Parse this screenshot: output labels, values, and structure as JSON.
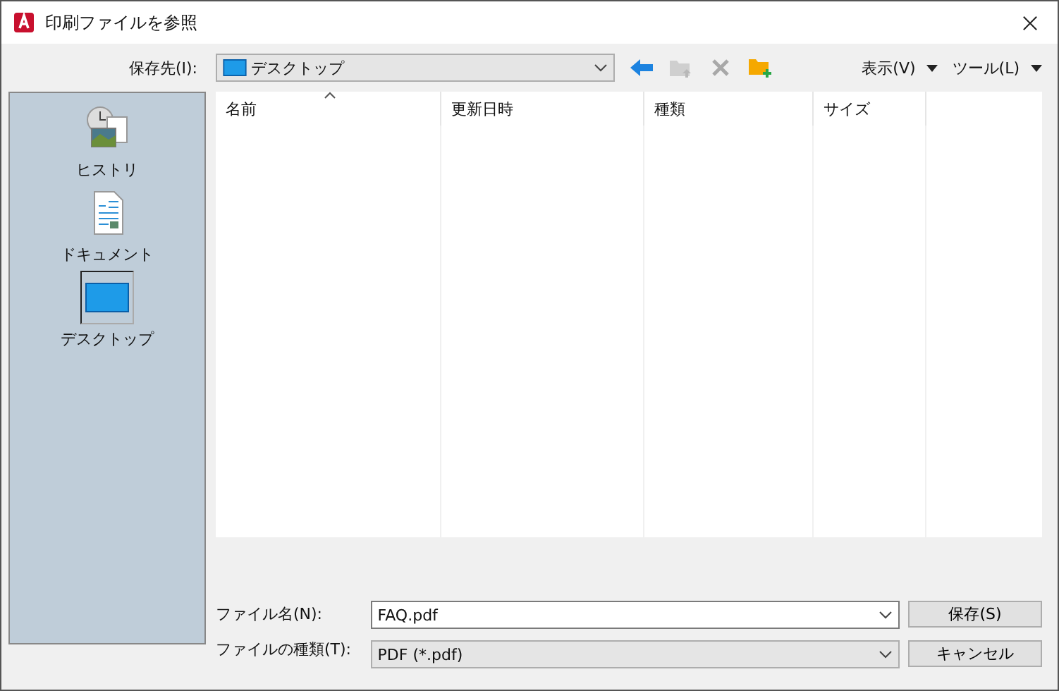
{
  "window": {
    "title": "印刷ファイルを参照"
  },
  "toolbar": {
    "location_label": "保存先(I):",
    "location_value": "デスクトップ",
    "menus": [
      "表示(V)",
      "ツール(L)"
    ]
  },
  "sidebar": {
    "items": [
      {
        "label": "ヒストリ",
        "kind": "history",
        "selected": false
      },
      {
        "label": "ドキュメント",
        "kind": "document",
        "selected": false
      },
      {
        "label": "デスクトップ",
        "kind": "desktop",
        "selected": true
      }
    ]
  },
  "table": {
    "columns": [
      {
        "label": "名前",
        "sorted": true
      },
      {
        "label": "更新日時",
        "sorted": false
      },
      {
        "label": "種類",
        "sorted": false
      },
      {
        "label": "サイズ",
        "sorted": false
      }
    ]
  },
  "form": {
    "fields": [
      {
        "label": "ファイル名(N):",
        "value": "FAQ.pdf",
        "editable": true
      },
      {
        "label": "ファイルの種類(T):",
        "value": "PDF (*.pdf)",
        "editable": false
      }
    ],
    "buttons": [
      "保存(S)",
      "キャンセル"
    ]
  }
}
